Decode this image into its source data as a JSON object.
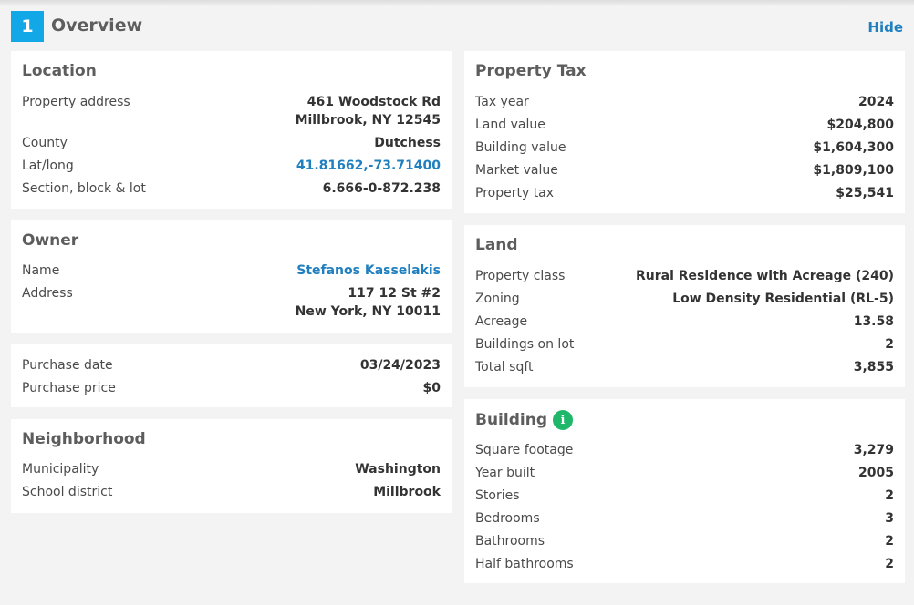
{
  "header": {
    "step": "1",
    "title": "Overview",
    "hide_label": "Hide"
  },
  "location": {
    "title": "Location",
    "address_label": "Property address",
    "address_line1": "461 Woodstock Rd",
    "address_line2": "Millbrook, NY 12545",
    "county_label": "County",
    "county": "Dutchess",
    "latlong_label": "Lat/long",
    "latlong": "41.81662,-73.71400",
    "sbl_label": "Section, block & lot",
    "sbl": "6.666-0-872.238"
  },
  "owner": {
    "title": "Owner",
    "name_label": "Name",
    "name": "Stefanos Kasselakis",
    "address_label": "Address",
    "address_line1": "117 12 St #2",
    "address_line2": "New York, NY 10011"
  },
  "purchase": {
    "date_label": "Purchase date",
    "date": "03/24/2023",
    "price_label": "Purchase price",
    "price": "$0"
  },
  "neighborhood": {
    "title": "Neighborhood",
    "municipality_label": "Municipality",
    "municipality": "Washington",
    "school_label": "School district",
    "school": "Millbrook"
  },
  "property_tax": {
    "title": "Property Tax",
    "rows": [
      {
        "label": "Tax year",
        "value": "2024"
      },
      {
        "label": "Land value",
        "value": "$204,800"
      },
      {
        "label": "Building value",
        "value": "$1,604,300"
      },
      {
        "label": "Market value",
        "value": "$1,809,100"
      },
      {
        "label": "Property tax",
        "value": "$25,541"
      }
    ]
  },
  "land": {
    "title": "Land",
    "rows": [
      {
        "label": "Property class",
        "value": "Rural Residence with Acreage (240)"
      },
      {
        "label": "Zoning",
        "value": "Low Density Residential (RL-5)"
      },
      {
        "label": "Acreage",
        "value": "13.58"
      },
      {
        "label": "Buildings on lot",
        "value": "2"
      },
      {
        "label": "Total sqft",
        "value": "3,855"
      }
    ]
  },
  "building": {
    "title": "Building",
    "info_icon": "info-icon",
    "info_glyph": "i",
    "rows": [
      {
        "label": "Square footage",
        "value": "3,279"
      },
      {
        "label": "Year built",
        "value": "2005"
      },
      {
        "label": "Stories",
        "value": "2"
      },
      {
        "label": "Bedrooms",
        "value": "3"
      },
      {
        "label": "Bathrooms",
        "value": "2"
      },
      {
        "label": "Half bathrooms",
        "value": "2"
      }
    ]
  }
}
